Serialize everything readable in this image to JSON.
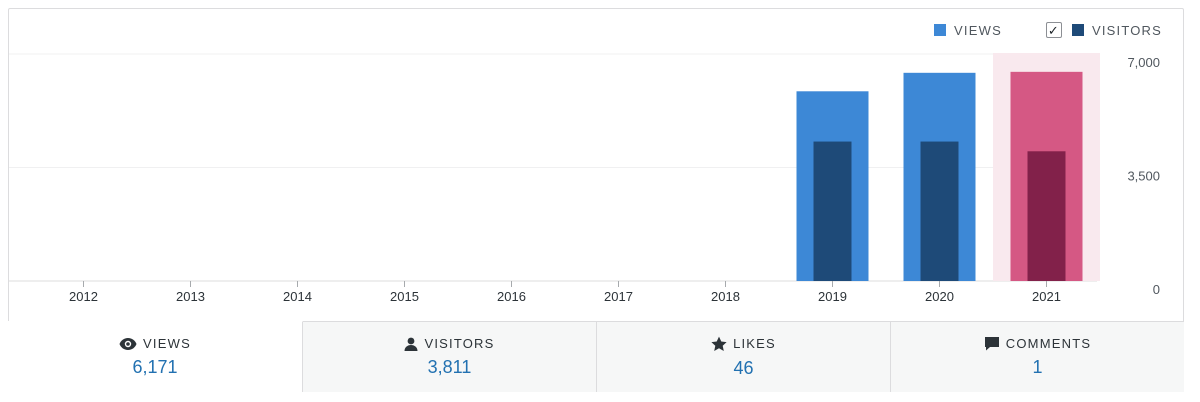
{
  "legend": {
    "views_label": "VIEWS",
    "visitors_label": "VISITORS",
    "visitors_checked": true
  },
  "colors": {
    "views": "#3d88d6",
    "visitors": "#1e4a78",
    "highlight_views": "#d55884",
    "highlight_visitors": "#82214a",
    "highlight_band": "#f9e9ee",
    "grid": "#f0f0f1",
    "axis_text": "#50575e"
  },
  "chart_data": {
    "type": "bar",
    "categories": [
      "2012",
      "2013",
      "2014",
      "2015",
      "2016",
      "2017",
      "2018",
      "2019",
      "2020",
      "2021"
    ],
    "series": [
      {
        "name": "VIEWS",
        "values": [
          0,
          0,
          0,
          0,
          0,
          0,
          0,
          5850,
          6420,
          6450
        ]
      },
      {
        "name": "VISITORS",
        "values": [
          0,
          0,
          0,
          0,
          0,
          0,
          0,
          4300,
          4300,
          4000
        ]
      }
    ],
    "y_ticks": [
      "7,000",
      "3,500",
      "0"
    ],
    "ylim": [
      0,
      7000
    ],
    "grid": true,
    "highlighted_category": "2021",
    "legend_position": "top-right"
  },
  "stats": [
    {
      "label": "VIEWS",
      "value": "6,171",
      "icon": "eye-icon",
      "active": true
    },
    {
      "label": "VISITORS",
      "value": "3,811",
      "icon": "person-icon",
      "active": false
    },
    {
      "label": "LIKES",
      "value": "46",
      "icon": "star-icon",
      "active": false
    },
    {
      "label": "COMMENTS",
      "value": "1",
      "icon": "comment-icon",
      "active": false
    }
  ]
}
